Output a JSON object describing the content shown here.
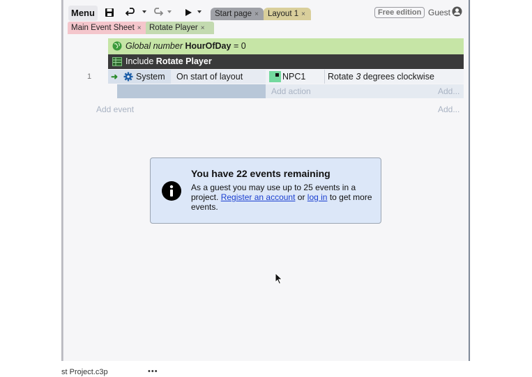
{
  "toolbar": {
    "menu_label": "Menu",
    "icons": [
      "save-icon",
      "undo-icon",
      "redo-icon",
      "play-icon"
    ],
    "tabs": [
      {
        "label": "Start page",
        "close": "×"
      },
      {
        "label": "Layout 1",
        "close": "×"
      }
    ],
    "edition_badge": "Free edition",
    "user_label": "Guest"
  },
  "sheet_tabs": [
    {
      "label": "Main Event Sheet",
      "close": "×",
      "color": "#f4c6cc"
    },
    {
      "label": "Rotate Player",
      "close": "×",
      "color": "#c3dab0"
    }
  ],
  "event_sheet": {
    "global_var": {
      "prefix": "Global number",
      "name": "HourOfDay",
      "value": "= 0"
    },
    "include": {
      "prefix": "Include",
      "name": "Rotate Player"
    },
    "event": {
      "number": "1",
      "condition_object": "System",
      "condition_text": "On start of layout",
      "action_object": "NPC1",
      "action_text_pre": "Rotate",
      "action_text_num": "3",
      "action_text_post": "degrees clockwise"
    },
    "add_action": "Add action",
    "add_action_right": "Add...",
    "add_event": "Add event",
    "add_event_right": "Add..."
  },
  "notice": {
    "title": "You have 22 events remaining",
    "body_1": "As a guest you may use up to 25 events in a project.",
    "link_register": "Register an account",
    "body_2": "or",
    "link_login": "log in",
    "body_3": "to get more events."
  },
  "status": {
    "file": "st Project.c3p",
    "more": "•••"
  },
  "colors": {
    "global_var_bg": "#c6e5a6",
    "include_bg": "#3a3a3a",
    "notice_bg": "#dce7f8",
    "link": "#1a3fd0"
  }
}
